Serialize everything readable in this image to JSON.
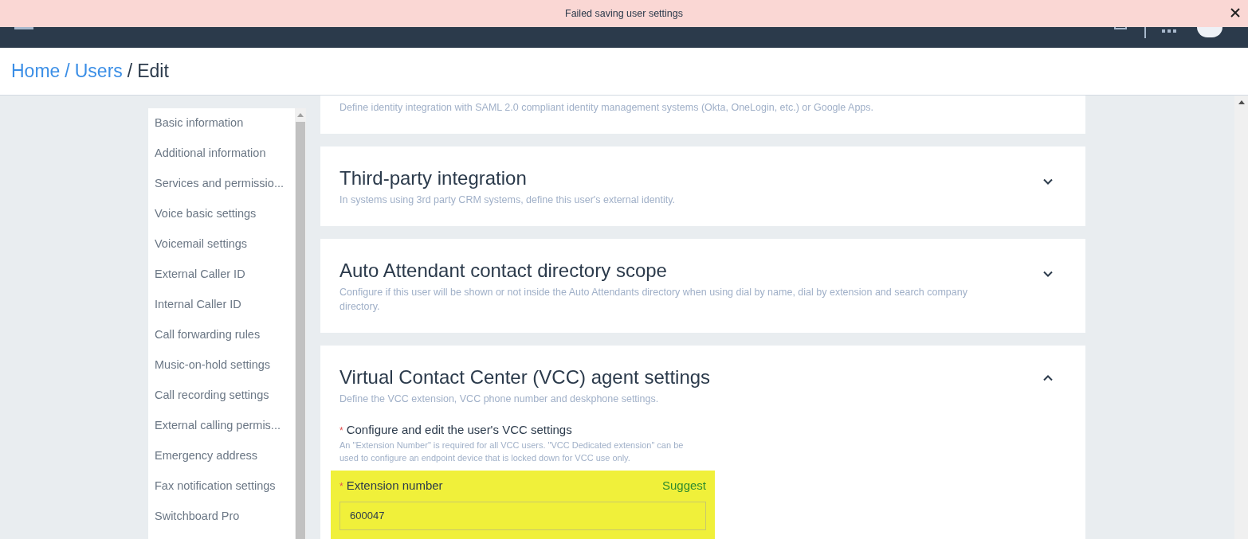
{
  "alert": {
    "message": "Failed saving user settings"
  },
  "breadcrumb": [
    {
      "label": "Home",
      "link": true
    },
    {
      "separator": "/",
      "label": "Users",
      "link": true
    },
    {
      "separator": "/",
      "label": "Edit",
      "link": false
    }
  ],
  "sidebar": {
    "items": [
      {
        "label": "Basic information"
      },
      {
        "label": "Additional information"
      },
      {
        "label": "Services and permissio..."
      },
      {
        "label": "Voice basic settings"
      },
      {
        "label": "Voicemail settings"
      },
      {
        "label": "External Caller ID"
      },
      {
        "label": "Internal Caller ID"
      },
      {
        "label": "Call forwarding rules"
      },
      {
        "label": "Music-on-hold settings"
      },
      {
        "label": "Call recording settings"
      },
      {
        "label": "External calling permis..."
      },
      {
        "label": "Emergency address"
      },
      {
        "label": "Fax notification settings"
      },
      {
        "label": "Switchboard Pro"
      }
    ]
  },
  "sections": [
    {
      "description": "Define identity integration with SAML 2.0 compliant identity management systems (Okta, OneLogin, etc.) or Google Apps."
    },
    {
      "title": "Third-party integration",
      "description": "In systems using 3rd party CRM systems, define this user's external identity.",
      "expanded": false
    },
    {
      "title": "Auto Attendant contact directory scope",
      "description": "Configure if this user will be shown or not inside the Auto Attendants directory when using dial by name, dial by extension and search company directory.",
      "expanded": false
    },
    {
      "title": "Virtual Contact Center (VCC) agent settings",
      "description": "Define the VCC extension, VCC phone number and deskphone settings.",
      "expanded": true,
      "group": {
        "label": "Configure and edit the user's VCC settings",
        "required": true,
        "required_mark": "*",
        "help": "An \"Extension Number\" is required for all VCC users. \"VCC Dedicated extension\" can be used to configure an endpoint device that is locked down for VCC use only."
      },
      "field": {
        "label": "Extension number",
        "required": true,
        "required_mark": "*",
        "action": "Suggest",
        "value": "600047",
        "highlighted": true
      }
    }
  ]
}
